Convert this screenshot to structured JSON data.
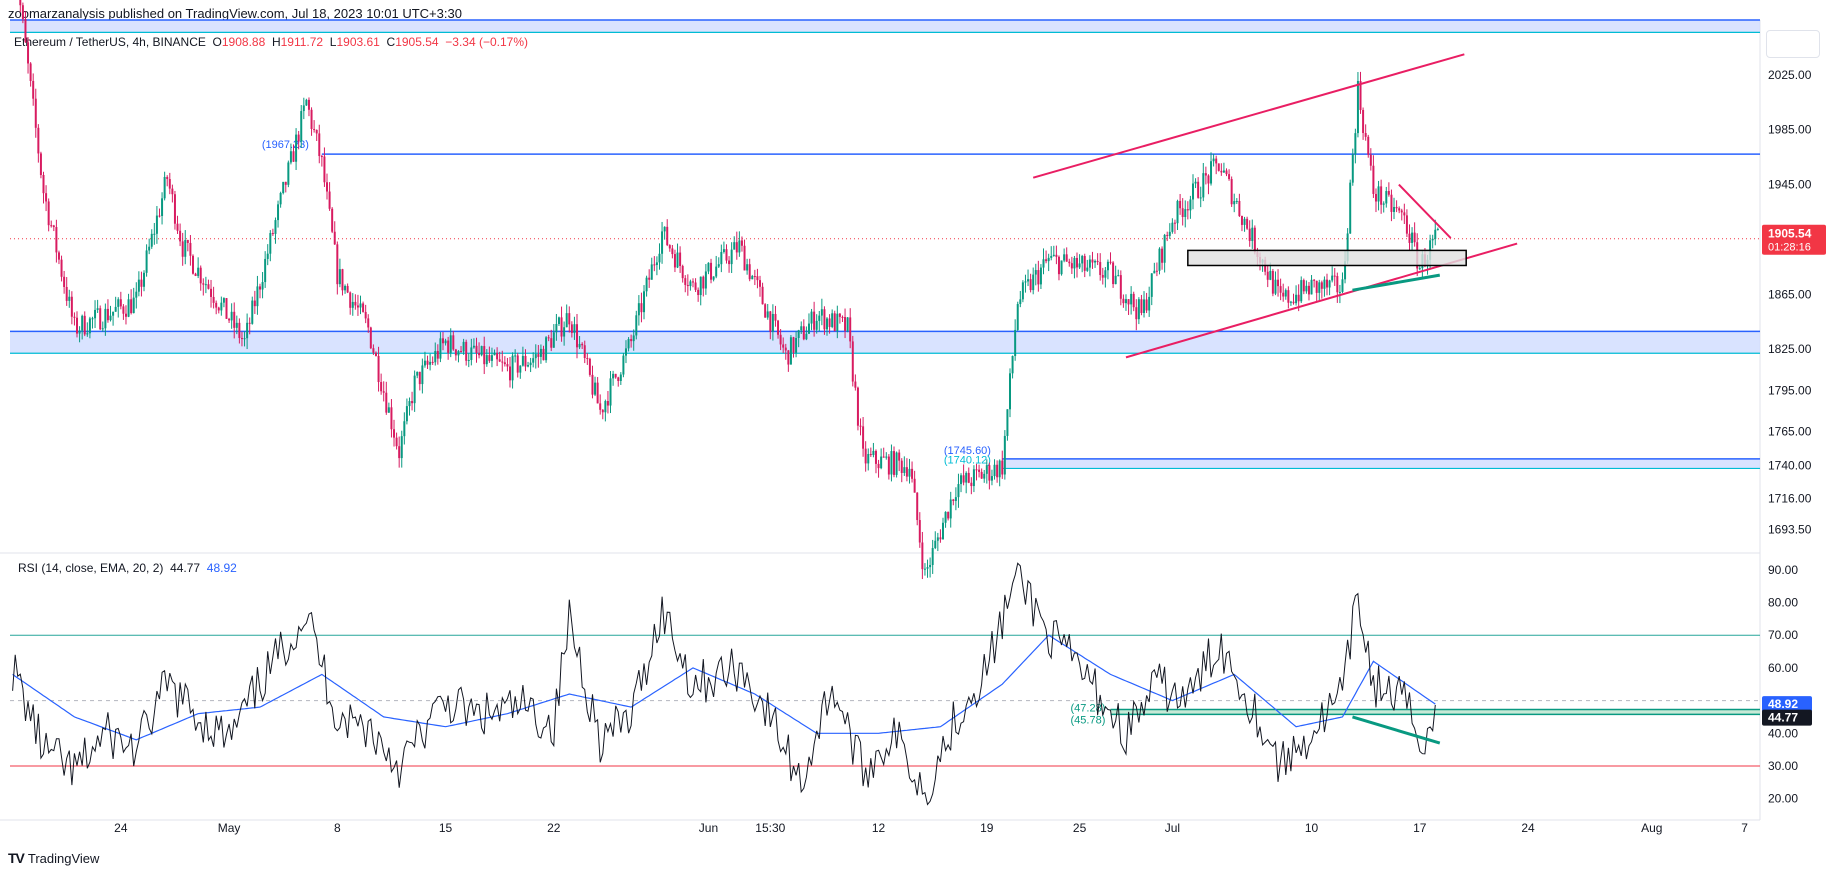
{
  "header": {
    "published": "zoomarzanalysis published on TradingView.com, Jul 18, 2023 10:01 UTC+3:30"
  },
  "symbol": {
    "name": "Ethereum / TetherUS, 4h, BINANCE",
    "open_label": "O",
    "open": "1908.88",
    "high_label": "H",
    "high": "1911.72",
    "low_label": "L",
    "low": "1903.61",
    "close_label": "C",
    "close": "1905.54",
    "change": "−3.34 (−0.17%)"
  },
  "rsi": {
    "title": "RSI (14, close, EMA, 20, 2)",
    "value": "44.77",
    "ma_value": "48.92"
  },
  "footer": {
    "brand": "TradingView"
  },
  "colors": {
    "up": "#089981",
    "down": "#f23645",
    "candle_down": "#d81b60",
    "level_line": "#2962ff",
    "zone_fill": "#cfdcff",
    "trend": "#e91e63",
    "divergence": "#089981",
    "rsi_line": "#131722",
    "rsi_ma": "#2962ff"
  },
  "chart_data": [
    {
      "type": "candlestick",
      "title": "",
      "price_ticks": [
        "2025.00",
        "1985.00",
        "1945.00",
        "1865.00",
        "1825.00",
        "1795.00",
        "1765.00",
        "1740.00",
        "1716.00",
        "1693.50"
      ],
      "ylim": [
        1680,
        2065
      ],
      "current_price": "1905.54",
      "countdown": "01:28:16",
      "x_ticks": [
        "24",
        "May",
        "8",
        "15",
        "22",
        "Jun",
        "15:30",
        "12",
        "19",
        "25",
        "Jul",
        "10",
        "17",
        "24",
        "Aug",
        "7"
      ],
      "levels": [
        {
          "price": 1967.23,
          "label": "(1967.23)"
        },
        {
          "price": 1745.6,
          "label": "(1745.60)"
        },
        {
          "price": 1740.12,
          "label": "(1740.12)"
        }
      ],
      "zones": [
        [
          2056,
          2065
        ],
        [
          1822,
          1838
        ],
        [
          1738,
          1745
        ]
      ],
      "key_points": [
        {
          "date": "Apr 17",
          "price": 2120
        },
        {
          "date": "Apr 19",
          "price": 1940
        },
        {
          "date": "Apr 21",
          "price": 1840
        },
        {
          "date": "Apr 25",
          "price": 1860
        },
        {
          "date": "Apr 27",
          "price": 1950
        },
        {
          "date": "Apr 28",
          "price": 1900
        },
        {
          "date": "May 2",
          "price": 1830
        },
        {
          "date": "May 6",
          "price": 2005
        },
        {
          "date": "May 7",
          "price": 1960
        },
        {
          "date": "May 8",
          "price": 1880
        },
        {
          "date": "May 10",
          "price": 1840
        },
        {
          "date": "May 12",
          "price": 1750
        },
        {
          "date": "May 13",
          "price": 1800
        },
        {
          "date": "May 15",
          "price": 1830
        },
        {
          "date": "May 19",
          "price": 1810
        },
        {
          "date": "May 21",
          "price": 1820
        },
        {
          "date": "May 23",
          "price": 1850
        },
        {
          "date": "May 25",
          "price": 1780
        },
        {
          "date": "May 27",
          "price": 1830
        },
        {
          "date": "May 29",
          "price": 1910
        },
        {
          "date": "May 31",
          "price": 1870
        },
        {
          "date": "Jun 3",
          "price": 1900
        },
        {
          "date": "Jun 6",
          "price": 1820
        },
        {
          "date": "Jun 8",
          "price": 1850
        },
        {
          "date": "Jun 10",
          "price": 1840
        },
        {
          "date": "Jun 11",
          "price": 1745
        },
        {
          "date": "Jun 14",
          "price": 1740
        },
        {
          "date": "Jun 15",
          "price": 1660
        },
        {
          "date": "Jun 17",
          "price": 1725
        },
        {
          "date": "Jun 20",
          "price": 1740
        },
        {
          "date": "Jun 21",
          "price": 1860
        },
        {
          "date": "Jun 23",
          "price": 1890
        },
        {
          "date": "Jun 27",
          "price": 1880
        },
        {
          "date": "Jun 29",
          "price": 1850
        },
        {
          "date": "Jul 1",
          "price": 1920
        },
        {
          "date": "Jul 4",
          "price": 1960
        },
        {
          "date": "Jul 6",
          "price": 1910
        },
        {
          "date": "Jul 8",
          "price": 1860
        },
        {
          "date": "Jul 10",
          "price": 1870
        },
        {
          "date": "Jul 12",
          "price": 1870
        },
        {
          "date": "Jul 13",
          "price": 2015
        },
        {
          "date": "Jul 14",
          "price": 1940
        },
        {
          "date": "Jul 16",
          "price": 1920
        },
        {
          "date": "Jul 17",
          "price": 1885
        },
        {
          "date": "Jul 18",
          "price": 1905.54
        }
      ]
    },
    {
      "type": "line",
      "title": "RSI (14, close, EMA, 20, 2)",
      "y_ticks": [
        "90.00",
        "80.00",
        "70.00",
        "60.00",
        "40.00",
        "30.00",
        "20.00"
      ],
      "ylim": [
        15,
        93
      ],
      "bands": [
        70,
        30
      ],
      "series": [
        {
          "name": "RSI",
          "values": [
            {
              "date": "Apr 17",
              "y": 60
            },
            {
              "date": "Apr 19",
              "y": 35
            },
            {
              "date": "Apr 21",
              "y": 28
            },
            {
              "date": "Apr 23",
              "y": 40
            },
            {
              "date": "Apr 25",
              "y": 35
            },
            {
              "date": "Apr 27",
              "y": 55
            },
            {
              "date": "Apr 29",
              "y": 45
            },
            {
              "date": "May 1",
              "y": 38
            },
            {
              "date": "May 3",
              "y": 55
            },
            {
              "date": "May 6",
              "y": 77
            },
            {
              "date": "May 8",
              "y": 45
            },
            {
              "date": "May 10",
              "y": 42
            },
            {
              "date": "May 12",
              "y": 30
            },
            {
              "date": "May 15",
              "y": 50
            },
            {
              "date": "May 17",
              "y": 45
            },
            {
              "date": "May 20",
              "y": 48
            },
            {
              "date": "May 22",
              "y": 42
            },
            {
              "date": "May 23",
              "y": 75
            },
            {
              "date": "May 25",
              "y": 38
            },
            {
              "date": "May 27",
              "y": 45
            },
            {
              "date": "May 29",
              "y": 78
            },
            {
              "date": "May 31",
              "y": 55
            },
            {
              "date": "Jun 3",
              "y": 60
            },
            {
              "date": "Jun 5",
              "y": 45
            },
            {
              "date": "Jun 7",
              "y": 25
            },
            {
              "date": "Jun 9",
              "y": 55
            },
            {
              "date": "Jun 11",
              "y": 28
            },
            {
              "date": "Jun 13",
              "y": 40
            },
            {
              "date": "Jun 15",
              "y": 22
            },
            {
              "date": "Jun 17",
              "y": 45
            },
            {
              "date": "Jun 19",
              "y": 60
            },
            {
              "date": "Jun 21",
              "y": 89
            },
            {
              "date": "Jun 23",
              "y": 70
            },
            {
              "date": "Jun 25",
              "y": 60
            },
            {
              "date": "Jun 28",
              "y": 40
            },
            {
              "date": "Jun 30",
              "y": 55
            },
            {
              "date": "Jul 2",
              "y": 50
            },
            {
              "date": "Jul 4",
              "y": 68
            },
            {
              "date": "Jul 6",
              "y": 50
            },
            {
              "date": "Jul 8",
              "y": 30
            },
            {
              "date": "Jul 10",
              "y": 40
            },
            {
              "date": "Jul 12",
              "y": 52
            },
            {
              "date": "Jul 13",
              "y": 82
            },
            {
              "date": "Jul 14",
              "y": 55
            },
            {
              "date": "Jul 16",
              "y": 50
            },
            {
              "date": "Jul 17",
              "y": 38
            },
            {
              "date": "Jul 18",
              "y": 44.77
            }
          ]
        },
        {
          "name": "RSI-based MA",
          "values": [
            {
              "date": "Apr 17",
              "y": 58
            },
            {
              "date": "Apr 21",
              "y": 45
            },
            {
              "date": "Apr 25",
              "y": 38
            },
            {
              "date": "Apr 29",
              "y": 46
            },
            {
              "date": "May 3",
              "y": 48
            },
            {
              "date": "May 7",
              "y": 58
            },
            {
              "date": "May 11",
              "y": 45
            },
            {
              "date": "May 15",
              "y": 42
            },
            {
              "date": "May 19",
              "y": 46
            },
            {
              "date": "May 23",
              "y": 52
            },
            {
              "date": "May 27",
              "y": 48
            },
            {
              "date": "May 31",
              "y": 60
            },
            {
              "date": "Jun 4",
              "y": 52
            },
            {
              "date": "Jun 8",
              "y": 40
            },
            {
              "date": "Jun 12",
              "y": 40
            },
            {
              "date": "Jun 16",
              "y": 42
            },
            {
              "date": "Jun 20",
              "y": 55
            },
            {
              "date": "Jun 23",
              "y": 70
            },
            {
              "date": "Jun 27",
              "y": 58
            },
            {
              "date": "Jul 1",
              "y": 50
            },
            {
              "date": "Jul 5",
              "y": 58
            },
            {
              "date": "Jul 9",
              "y": 42
            },
            {
              "date": "Jul 12",
              "y": 45
            },
            {
              "date": "Jul 14",
              "y": 62
            },
            {
              "date": "Jul 18",
              "y": 48.92
            }
          ]
        }
      ],
      "annotations": [
        "(47.28)",
        "(45.78)"
      ]
    }
  ]
}
